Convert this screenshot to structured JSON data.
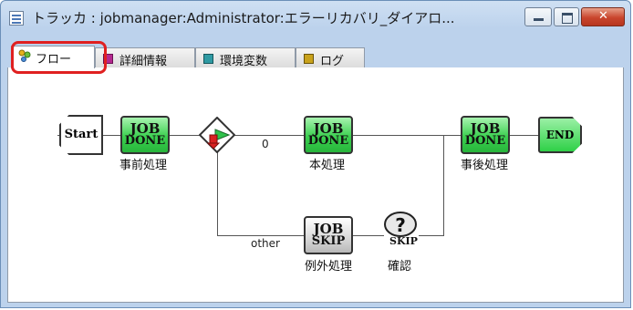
{
  "window": {
    "title": "トラッカ : jobmanager:Administrator:エラーリカバリ_ダイアロ..."
  },
  "tabs": [
    {
      "label": "フロー",
      "icon": "flow-icon",
      "active": true
    },
    {
      "label": "詳細情報",
      "icon": "detail-icon",
      "active": false
    },
    {
      "label": "環境変数",
      "icon": "env-icon",
      "active": false
    },
    {
      "label": "ログ",
      "icon": "log-icon",
      "active": false
    }
  ],
  "flow": {
    "start_label": "Start",
    "end_label": "END",
    "jobs": [
      {
        "line1": "JOB",
        "line2": "DONE",
        "caption": "事前処理",
        "status": "done"
      },
      {
        "line1": "JOB",
        "line2": "DONE",
        "caption": "本処理",
        "status": "done"
      },
      {
        "line1": "JOB",
        "line2": "DONE",
        "caption": "事後処理",
        "status": "done"
      },
      {
        "line1": "JOB",
        "line2": "SKIP",
        "caption": "例外処理",
        "status": "skip"
      }
    ],
    "confirm": {
      "symbol": "?",
      "badge": "SKIP",
      "caption": "確認"
    },
    "branch_labels": {
      "main": "0",
      "other": "other"
    }
  },
  "colors": {
    "done": "#3cd050",
    "skip": "#c8c8c8",
    "highlight": "#e02020"
  }
}
